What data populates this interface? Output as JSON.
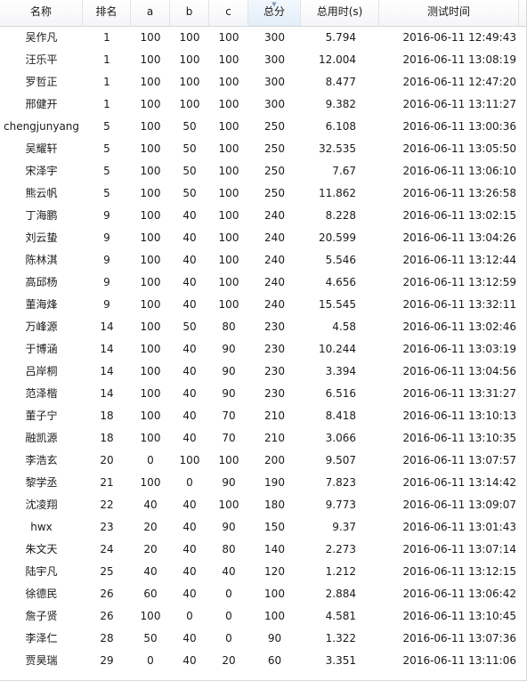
{
  "table": {
    "columns": [
      "名称",
      "排名",
      "a",
      "b",
      "c",
      "总分",
      "总用时(s)",
      "测试时间"
    ],
    "sorted_column_index": 5,
    "rows": [
      [
        "吴作凡",
        "1",
        "100",
        "100",
        "100",
        "300",
        "5.794",
        "2016-06-11 12:49:43"
      ],
      [
        "汪乐平",
        "1",
        "100",
        "100",
        "100",
        "300",
        "12.004",
        "2016-06-11 13:08:19"
      ],
      [
        "罗哲正",
        "1",
        "100",
        "100",
        "100",
        "300",
        "8.477",
        "2016-06-11 12:47:20"
      ],
      [
        "邢健开",
        "1",
        "100",
        "100",
        "100",
        "300",
        "9.382",
        "2016-06-11 13:11:27"
      ],
      [
        "chengjunyang",
        "5",
        "100",
        "50",
        "100",
        "250",
        "6.108",
        "2016-06-11 13:00:36"
      ],
      [
        "吴耀轩",
        "5",
        "100",
        "50",
        "100",
        "250",
        "32.535",
        "2016-06-11 13:05:50"
      ],
      [
        "宋泽宇",
        "5",
        "100",
        "50",
        "100",
        "250",
        "7.67",
        "2016-06-11 13:06:10"
      ],
      [
        "熊云帆",
        "5",
        "100",
        "50",
        "100",
        "250",
        "11.862",
        "2016-06-11 13:26:58"
      ],
      [
        "丁海鹏",
        "9",
        "100",
        "40",
        "100",
        "240",
        "8.228",
        "2016-06-11 13:02:15"
      ],
      [
        "刘云蛰",
        "9",
        "100",
        "40",
        "100",
        "240",
        "20.599",
        "2016-06-11 13:04:26"
      ],
      [
        "陈林淇",
        "9",
        "100",
        "40",
        "100",
        "240",
        "5.546",
        "2016-06-11 13:12:44"
      ],
      [
        "高邱杨",
        "9",
        "100",
        "40",
        "100",
        "240",
        "4.656",
        "2016-06-11 13:12:59"
      ],
      [
        "董海烽",
        "9",
        "100",
        "40",
        "100",
        "240",
        "15.545",
        "2016-06-11 13:32:11"
      ],
      [
        "万峰源",
        "14",
        "100",
        "50",
        "80",
        "230",
        "4.58",
        "2016-06-11 13:02:46"
      ],
      [
        "于博涵",
        "14",
        "100",
        "40",
        "90",
        "230",
        "10.244",
        "2016-06-11 13:03:19"
      ],
      [
        "吕岸桐",
        "14",
        "100",
        "40",
        "90",
        "230",
        "3.394",
        "2016-06-11 13:04:56"
      ],
      [
        "范泽楷",
        "14",
        "100",
        "40",
        "90",
        "230",
        "6.516",
        "2016-06-11 13:31:27"
      ],
      [
        "董子宁",
        "18",
        "100",
        "40",
        "70",
        "210",
        "8.418",
        "2016-06-11 13:10:13"
      ],
      [
        "融凯源",
        "18",
        "100",
        "40",
        "70",
        "210",
        "3.066",
        "2016-06-11 13:10:35"
      ],
      [
        "李浩玄",
        "20",
        "0",
        "100",
        "100",
        "200",
        "9.507",
        "2016-06-11 13:07:57"
      ],
      [
        "黎学丞",
        "21",
        "100",
        "0",
        "90",
        "190",
        "7.823",
        "2016-06-11 13:14:42"
      ],
      [
        "沈凌翔",
        "22",
        "40",
        "40",
        "100",
        "180",
        "9.773",
        "2016-06-11 13:09:07"
      ],
      [
        "hwx",
        "23",
        "20",
        "40",
        "90",
        "150",
        "9.37",
        "2016-06-11 13:01:43"
      ],
      [
        "朱文天",
        "24",
        "20",
        "40",
        "80",
        "140",
        "2.273",
        "2016-06-11 13:07:14"
      ],
      [
        "陆宇凡",
        "25",
        "40",
        "40",
        "40",
        "120",
        "1.212",
        "2016-06-11 13:12:15"
      ],
      [
        "徐德民",
        "26",
        "60",
        "40",
        "0",
        "100",
        "2.884",
        "2016-06-11 13:06:42"
      ],
      [
        "詹子贤",
        "26",
        "100",
        "0",
        "0",
        "100",
        "4.581",
        "2016-06-11 13:10:45"
      ],
      [
        "李泽仁",
        "28",
        "50",
        "40",
        "0",
        "90",
        "1.322",
        "2016-06-11 13:07:36"
      ],
      [
        "贾昊瑞",
        "29",
        "0",
        "40",
        "20",
        "60",
        "3.351",
        "2016-06-11 13:11:06"
      ]
    ]
  },
  "icons": {
    "sort_indicator": "sort-indicator-icon"
  },
  "colors": {
    "header_bg": "#f4f5f7",
    "sorted_header_bg": "#e3eef9",
    "grid_line": "#d9d9d9",
    "text": "#1a1a1a"
  }
}
